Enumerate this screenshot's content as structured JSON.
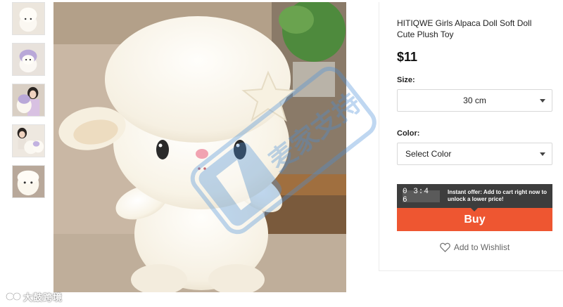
{
  "product": {
    "title": "HITIQWE Girls Alpaca Doll Soft Doll Cute Plush Toy",
    "price": "$11"
  },
  "size": {
    "label": "Size:",
    "selected": "30 cm"
  },
  "color": {
    "label": "Color:",
    "selected": "Select Color"
  },
  "offer": {
    "timer": "03:46",
    "text": "Instant offer: Add to cart right now to unlock a lower price!"
  },
  "buy_label": "Buy",
  "wishlist_label": "Add to Wishlist",
  "watermark_text": "麦家支持",
  "corner_logo_text": "大鼓跨境",
  "colors": {
    "buy": "#ee5631",
    "offer_bar": "#3d3d3d",
    "timer_bg": "#5a5a5a",
    "watermark": "#4a90d9"
  },
  "thumbnails": [
    {
      "name": "white-alpaca"
    },
    {
      "name": "purple-alpaca"
    },
    {
      "name": "girl-holding-alpaca"
    },
    {
      "name": "girl-with-alpacas"
    },
    {
      "name": "alpaca-closeup"
    }
  ],
  "icons": {
    "dropdown": "chevron-down-icon",
    "wishlist": "heart-icon"
  }
}
